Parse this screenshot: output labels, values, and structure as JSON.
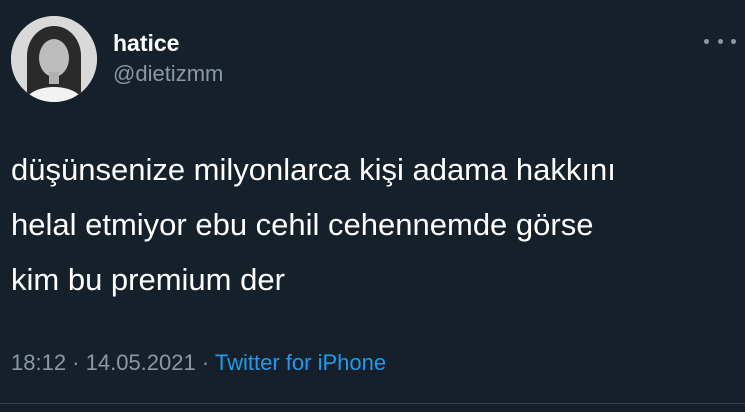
{
  "user": {
    "display_name": "hatice",
    "handle": "@dietizmm"
  },
  "tweet": {
    "text": "düşünsenize milyonlarca kişi adama hakkını\nhelal etmiyor ebu cehil cehennemde görse\nkim bu premium der",
    "time": "18:12",
    "separator": " · ",
    "date": "14.05.2021",
    "source": "Twitter for iPhone"
  },
  "icons": {
    "more": "more-horizontal-icon",
    "avatar": "profile-photo"
  },
  "colors": {
    "background": "#15202b",
    "text_primary": "#ffffff",
    "text_secondary": "#8b98a5",
    "link": "#1d9bf0"
  }
}
